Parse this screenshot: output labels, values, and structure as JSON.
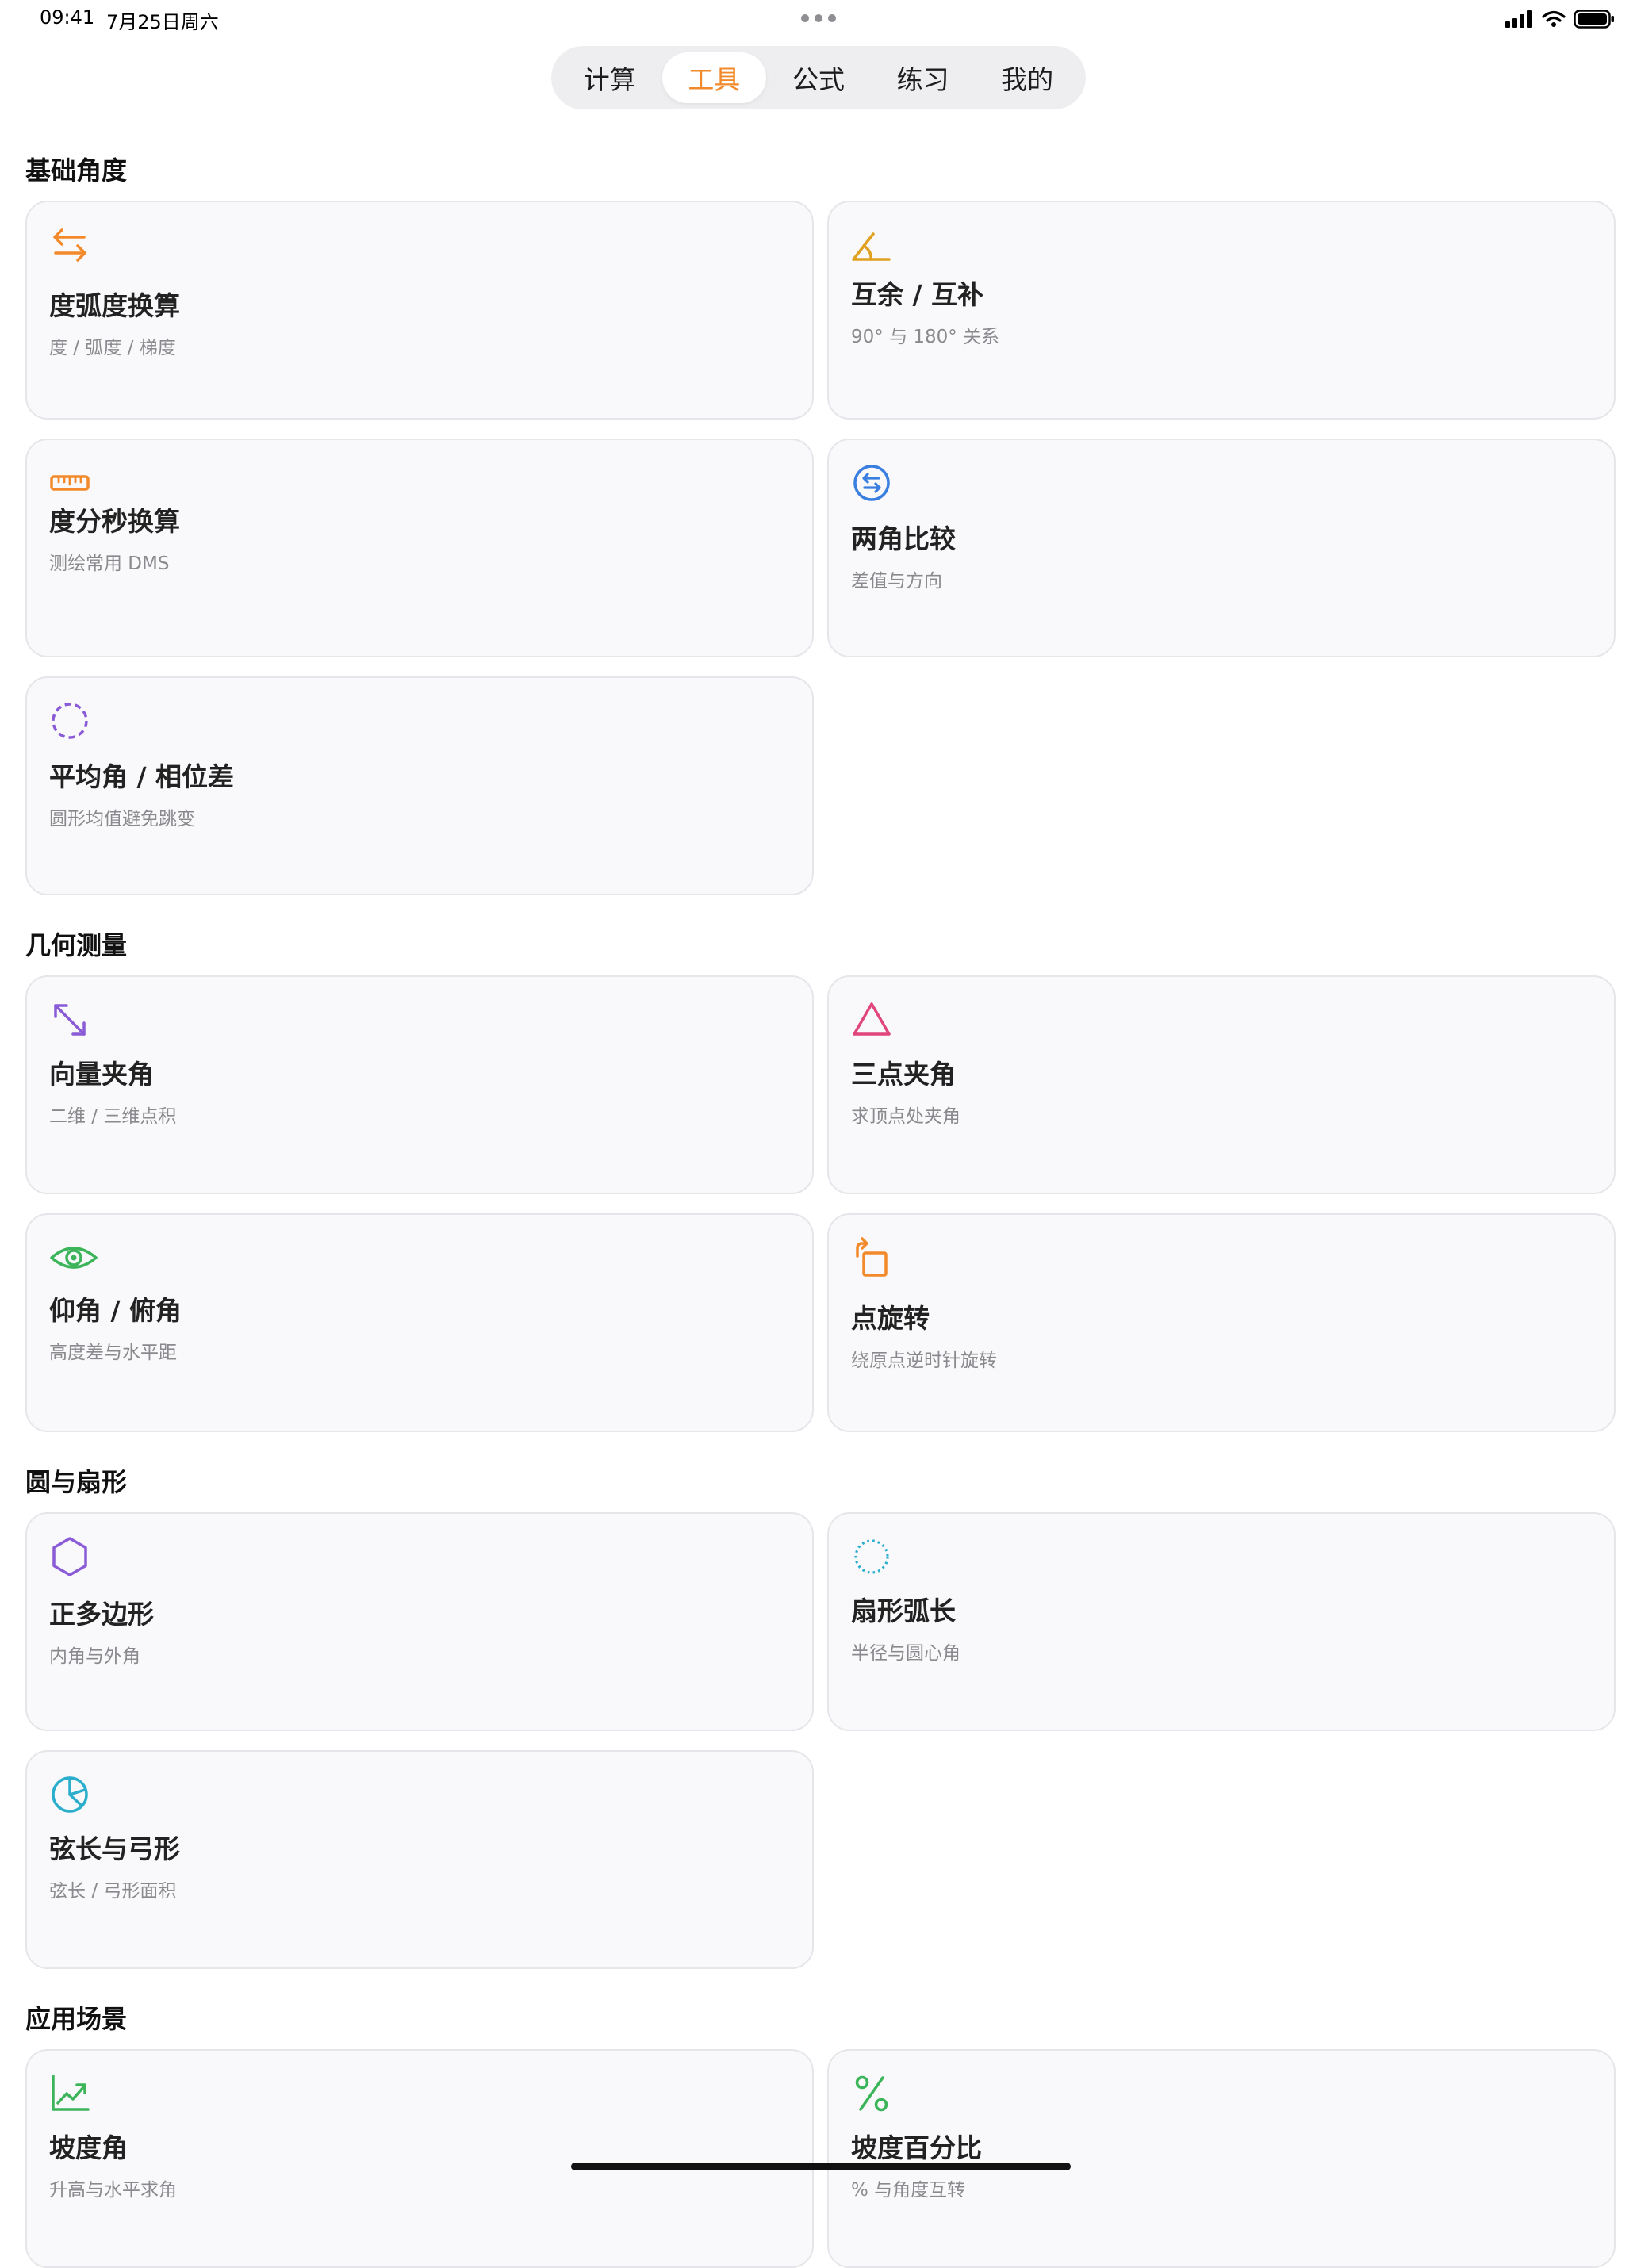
{
  "status": {
    "time": "09:41",
    "date": "7月25日周六"
  },
  "tabs": [
    {
      "label": "计算",
      "active": false
    },
    {
      "label": "工具",
      "active": true
    },
    {
      "label": "公式",
      "active": false
    },
    {
      "label": "练习",
      "active": false
    },
    {
      "label": "我的",
      "active": false
    }
  ],
  "colors": {
    "accent": "#f28a2b",
    "card_bg": "#f9f9fb",
    "card_border": "#e6e6ea"
  },
  "sections": [
    {
      "title": "基础角度",
      "cards": [
        {
          "icon": "arrows-swap-icon",
          "title": "度弧度换算",
          "subtitle": "度 / 弧度 / 梯度"
        },
        {
          "icon": "angle-icon",
          "title": "互余 / 互补",
          "subtitle": "90° 与 180° 关系"
        },
        {
          "icon": "ruler-icon",
          "title": "度分秒换算",
          "subtitle": "测绘常用 DMS"
        },
        {
          "icon": "circle-arrows-icon",
          "title": "两角比较",
          "subtitle": "差值与方向"
        },
        {
          "icon": "dashed-circle-icon",
          "title": "平均角 / 相位差",
          "subtitle": "圆形均值避免跳变"
        }
      ]
    },
    {
      "title": "几何测量",
      "cards": [
        {
          "icon": "diagonal-arrows-icon",
          "title": "向量夹角",
          "subtitle": "二维 / 三维点积"
        },
        {
          "icon": "triangle-icon",
          "title": "三点夹角",
          "subtitle": "求顶点处夹角"
        },
        {
          "icon": "eye-icon",
          "title": "仰角 / 俯角",
          "subtitle": "高度差与水平距"
        },
        {
          "icon": "rotate-square-icon",
          "title": "点旋转",
          "subtitle": "绕原点逆时针旋转"
        }
      ]
    },
    {
      "title": "圆与扇形",
      "cards": [
        {
          "icon": "hexagon-icon",
          "title": "正多边形",
          "subtitle": "内角与外角"
        },
        {
          "icon": "dotted-circle-icon",
          "title": "扇形弧长",
          "subtitle": "半径与圆心角"
        },
        {
          "icon": "pie-chart-icon",
          "title": "弦长与弓形",
          "subtitle": "弦长 / 弓形面积"
        }
      ]
    },
    {
      "title": "应用场景",
      "cards": [
        {
          "icon": "trend-chart-icon",
          "title": "坡度角",
          "subtitle": "升高与水平求角"
        },
        {
          "icon": "percent-icon",
          "title": "坡度百分比",
          "subtitle": "% 与角度互转"
        }
      ]
    }
  ]
}
